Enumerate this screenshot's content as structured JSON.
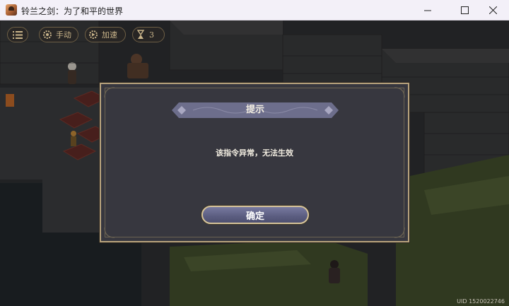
{
  "window": {
    "title": "铃兰之剑：为了和平的世界",
    "controls": [
      "minimize",
      "maximize",
      "close"
    ]
  },
  "hud": {
    "menu_icon": "list-menu-icon",
    "manual_label": "手动",
    "speed_label": "加速",
    "turn_count": "3"
  },
  "dialog": {
    "title": "提示",
    "message": "该指令异常，无法生效",
    "confirm_label": "确定"
  },
  "uid": "UID 1520022746",
  "colors": {
    "dialog_bg": "#37373f",
    "dialog_border": "#b7a27c",
    "button_fill": "#5b5d80",
    "title_bar": "#f3f0f8"
  }
}
